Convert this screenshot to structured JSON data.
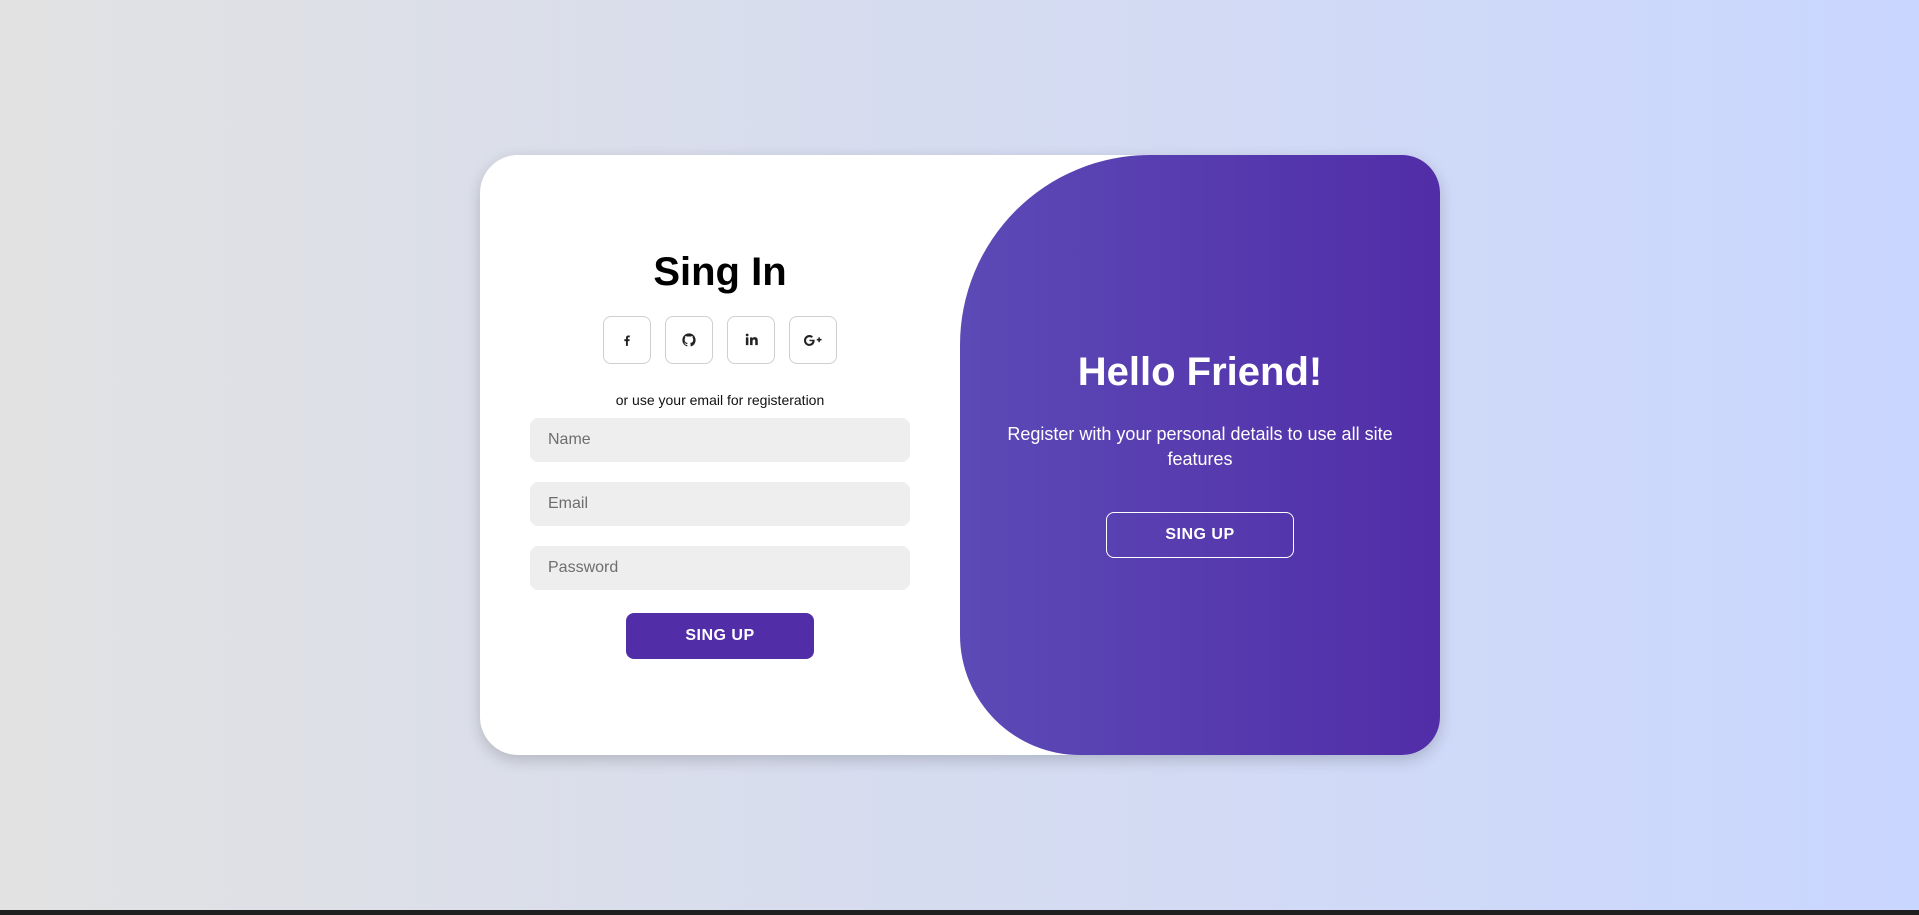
{
  "signin_form": {
    "title": "Sing In",
    "social_buttons": [
      {
        "icon": "facebook-icon"
      },
      {
        "icon": "github-icon"
      },
      {
        "icon": "linkedin-icon"
      },
      {
        "icon": "google-plus-icon"
      }
    ],
    "divider_text": "or use your email for registeration",
    "fields": {
      "name": {
        "placeholder": "Name",
        "value": ""
      },
      "email": {
        "placeholder": "Email",
        "value": ""
      },
      "password": {
        "placeholder": "Password",
        "value": ""
      }
    },
    "submit_label": "SING UP"
  },
  "toggle_panel": {
    "title": "Hello Friend!",
    "text": "Register with your personal details to use all site features",
    "button_label": "SING UP"
  },
  "colors": {
    "accent": "#512da8",
    "panel_gradient_start": "#5c4ab6",
    "input_bg": "#eeeeee",
    "page_gradient_start": "#e2e2e2",
    "page_gradient_end": "#c9d6ff"
  }
}
